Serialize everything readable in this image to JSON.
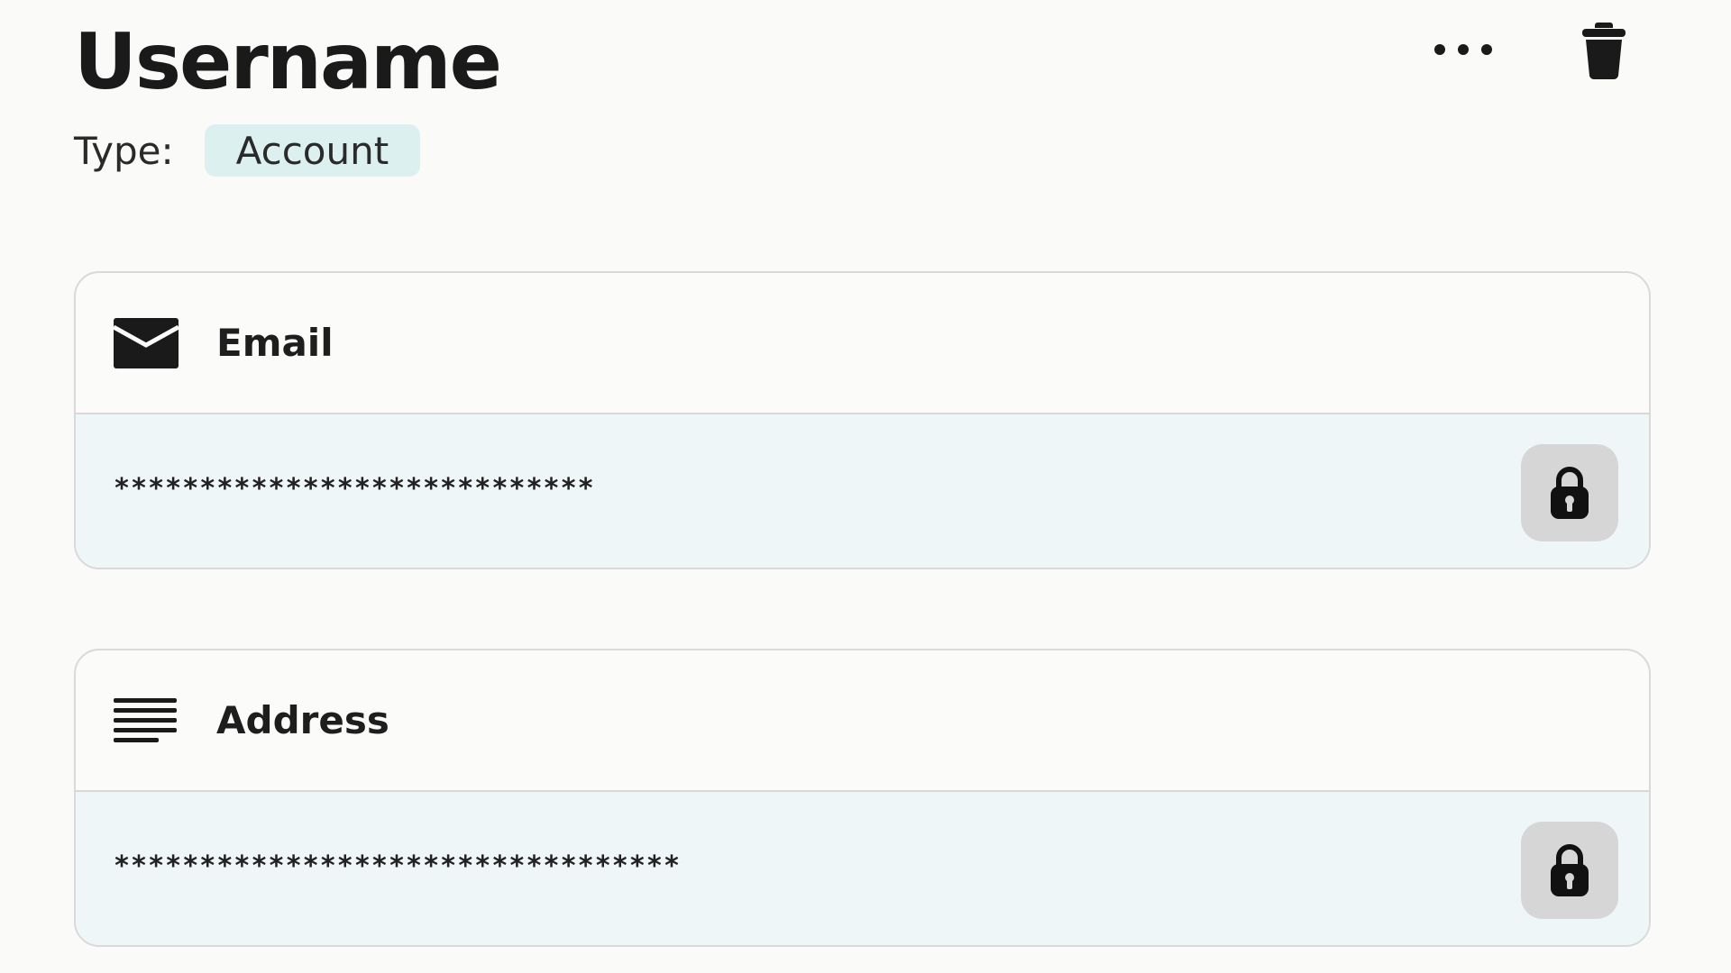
{
  "header": {
    "title": "Username",
    "type_label": "Type:",
    "type_value": "Account",
    "badge_color": "#ddf0f0"
  },
  "actions": {
    "more_icon": "more-horizontal-icon",
    "delete_icon": "trash-icon"
  },
  "fields": [
    {
      "label": "Email",
      "icon": "envelope-icon",
      "value": "****************************",
      "lock_icon": "lock-icon"
    },
    {
      "label": "Address",
      "icon": "text-lines-icon",
      "value": "*********************************",
      "lock_icon": "lock-icon"
    }
  ],
  "colors": {
    "background": "#fafaf8",
    "field_body": "#eff6f8",
    "lock_button": "#d6d6d6",
    "border": "#d9d9d9"
  }
}
